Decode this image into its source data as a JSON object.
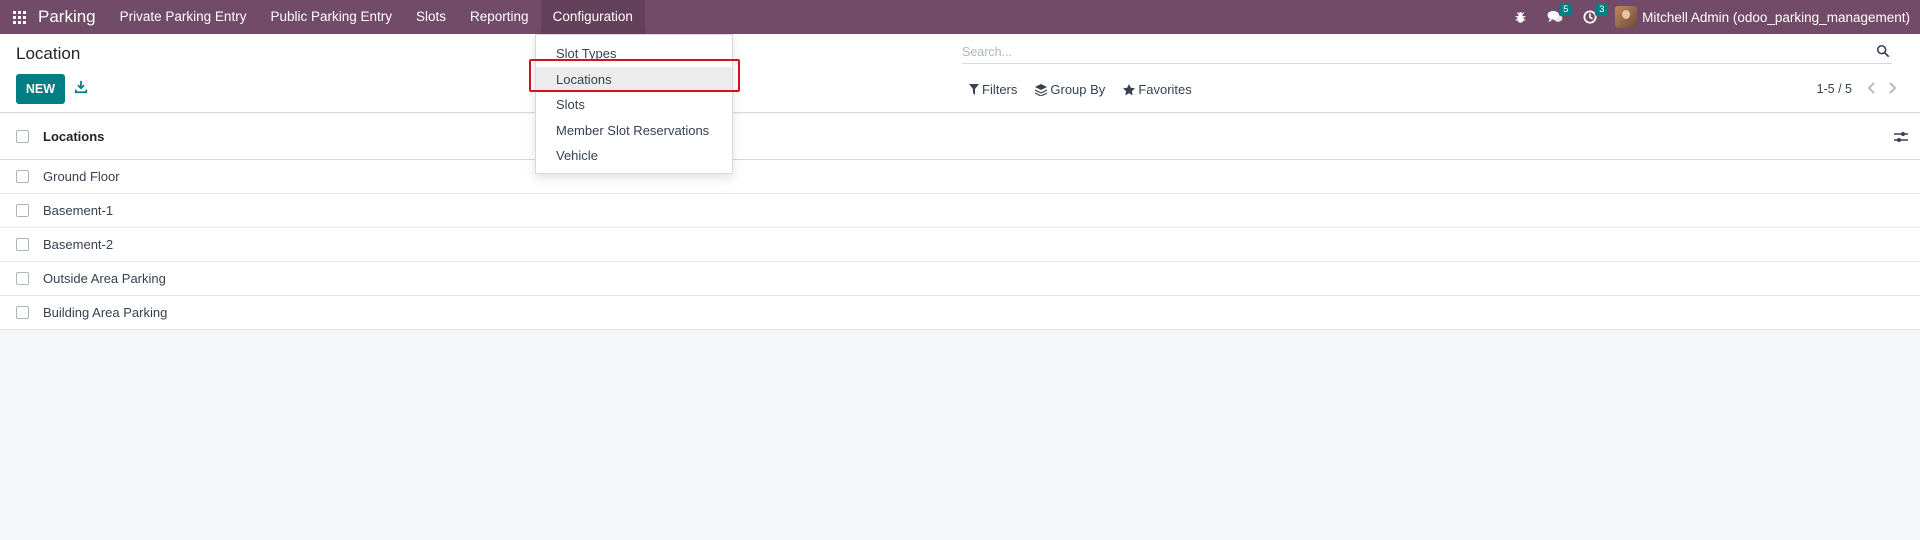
{
  "navbar": {
    "brand": "Parking",
    "menu": [
      "Private Parking Entry",
      "Public Parking Entry",
      "Slots",
      "Reporting",
      "Configuration"
    ],
    "messages_count": "5",
    "activities_count": "3",
    "user_name": "Mitchell Admin (odoo_parking_management)",
    "bg_color": "#714b67"
  },
  "control": {
    "title": "Location",
    "new_label": "NEW",
    "search_placeholder": "Search...",
    "filters_label": "Filters",
    "groupby_label": "Group By",
    "favorites_label": "Favorites",
    "pager": "1-5 / 5"
  },
  "dropdown": {
    "items": [
      "Slot Types",
      "Locations",
      "Slots",
      "Member Slot Reservations",
      "Vehicle"
    ],
    "highlighted": "Locations"
  },
  "list": {
    "column": "Locations",
    "rows": [
      "Ground Floor",
      "Basement-1",
      "Basement-2",
      "Outside Area Parking",
      "Building Area Parking"
    ]
  },
  "colors": {
    "accent": "#017e84",
    "highlight_border": "#d0141b"
  }
}
